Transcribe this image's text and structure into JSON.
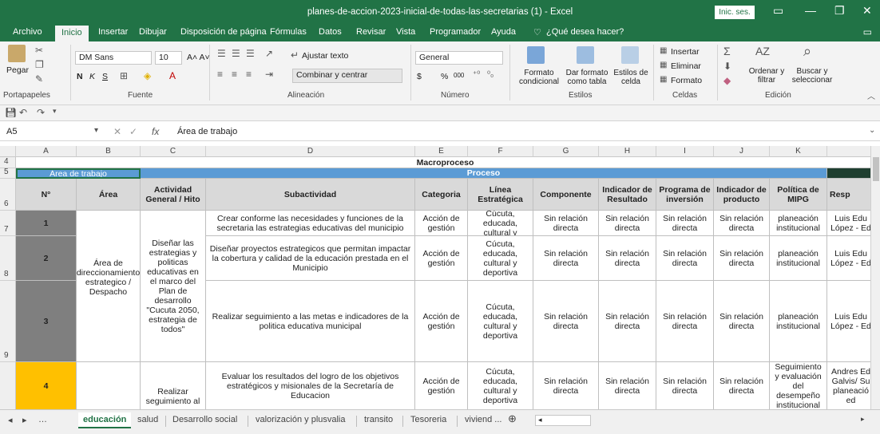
{
  "window": {
    "title": "planes-de-accion-2023-inicial-de-todas-las-secretarias (1)  -  Excel",
    "signin": "Inic. ses."
  },
  "tabs": [
    "Archivo",
    "Inicio",
    "Insertar",
    "Dibujar",
    "Disposición de página",
    "Fórmulas",
    "Datos",
    "Revisar",
    "Vista",
    "Programador",
    "Ayuda"
  ],
  "tell_me": "¿Qué desea hacer?",
  "ribbon": {
    "clipboard": {
      "paste": "Pegar",
      "label": "Portapapeles"
    },
    "font": {
      "name": "DM Sans",
      "size": "10",
      "bold": "N",
      "italic": "K",
      "underline": "S",
      "label": "Fuente"
    },
    "alignment": {
      "wrap": "Ajustar texto",
      "merge": "Combinar y centrar",
      "label": "Alineación"
    },
    "number": {
      "format": "General",
      "currency": "$",
      "percent": "%",
      "thousands": "000",
      "label": "Número"
    },
    "styles": {
      "conditional": "Formato condicional",
      "as_table": "Dar formato como tabla",
      "cell_styles": "Estilos de celda",
      "label": "Estilos"
    },
    "cells": {
      "insert": "Insertar",
      "delete": "Eliminar",
      "format": "Formato",
      "label": "Celdas"
    },
    "editing": {
      "sort": "Ordenar y filtrar",
      "find": "Buscar y seleccionar",
      "label": "Edición"
    }
  },
  "formula_bar": {
    "name_box": "A5",
    "fx": "fx",
    "content": "Área de trabajo"
  },
  "grid": {
    "columns": [
      "A",
      "B",
      "C",
      "D",
      "E",
      "F",
      "G",
      "H",
      "I",
      "J",
      "K"
    ],
    "row_numbers": [
      "4",
      "5",
      "6",
      "7",
      "8",
      "9"
    ],
    "macroproceso": "Macroproceso",
    "area_trabajo": "Área de trabajo",
    "proceso": "Proceso",
    "headers": [
      "N°",
      "Área",
      "Actividad General / Hito",
      "Subactividad",
      "Categoria",
      "Línea Estratégica",
      "Componente",
      "Indicador de Resultado",
      "Programa de inversión",
      "Indicador de producto",
      "Política de MIPG",
      "Resp"
    ],
    "area_value": "Área de direccionamiento estrategico / Despacho",
    "activity_1": "Diseñar las estrategias y politicas educativas en el marco del Plan de desarrollo \"Cucuta 2050, estrategia de todos\"",
    "activity_2": "Realizar seguimiento al",
    "rows": [
      {
        "n": "1",
        "sub": "Crear conforme las necesidades y funciones de la secretaria las estrategias educativas del municipio",
        "cat": "Acción de gestión",
        "linea": "Cúcuta, educada, cultural y",
        "comp": "Sin relación directa",
        "ind_res": "Sin relación directa",
        "prog": "Sin relación directa",
        "ind_prod": "Sin relación directa",
        "mipg": "planeación institucional",
        "resp": "Luis Edu López - Ed"
      },
      {
        "n": "2",
        "sub": "Diseñar proyectos estrategicos que permitan impactar la cobertura y calidad de la educación prestada en el Municipio",
        "cat": "Acción de gestión",
        "linea": "Cúcuta, educada, cultural y deportiva",
        "comp": "Sin relación directa",
        "ind_res": "Sin relación directa",
        "prog": "Sin relación directa",
        "ind_prod": "Sin relación directa",
        "mipg": "planeación institucional",
        "resp": "Luis Edu López - Ed"
      },
      {
        "n": "3",
        "sub": "Realizar seguimiento a las metas e indicadores de la politica educativa municipal",
        "cat": "Acción de gestión",
        "linea": "Cúcuta, educada, cultural y deportiva",
        "comp": "Sin relación directa",
        "ind_res": "Sin relación directa",
        "prog": "Sin relación directa",
        "ind_prod": "Sin relación directa",
        "mipg": "planeación institucional",
        "resp": "Luis Edu López - Ed"
      },
      {
        "n": "4",
        "sub": "Evaluar los resultados del logro de los objetivos estratégicos y misionales de la Secretaría de Educacion",
        "cat": "Acción de gestión",
        "linea": "Cúcuta, educada, cultural y deportiva",
        "comp": "Sin relación directa",
        "ind_res": "Sin relación directa",
        "prog": "Sin relación directa",
        "ind_prod": "Sin relación directa",
        "mipg": "Seguimiento y evaluación del desempeño institucional",
        "resp": "Andres Ed Galvis/ Su planeació ed"
      }
    ]
  },
  "sheets": [
    "educación",
    "salud",
    "Desarrollo social",
    "valorización y plusvalia",
    "transito",
    "Tesoreria",
    "viviend ..."
  ],
  "colors": {
    "excel_green": "#217346",
    "header_blue": "#5b9bd5",
    "row_gray": "#7f7f7f",
    "row_yellow": "#ffc000",
    "header_gray": "#d9d9d9"
  }
}
